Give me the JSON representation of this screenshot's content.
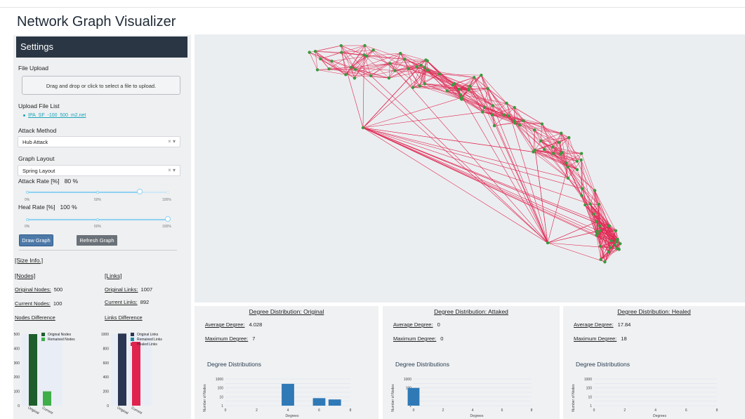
{
  "app": {
    "title": "Network Graph Visualizer"
  },
  "sidebar": {
    "header": "Settings",
    "file_upload": {
      "label": "File Upload",
      "dropzone": "Drag and drop or click to select a file to upload."
    },
    "upload_list": {
      "label": "Upload File List",
      "files": [
        "IPA_SF_-100_500_m2.net"
      ]
    },
    "attack_method": {
      "label": "Attack Method",
      "value": "Hub Attack",
      "clear": "×",
      "caret": "▾"
    },
    "graph_layout": {
      "label": "Graph Layout",
      "value": "Spring Layout",
      "clear": "×",
      "caret": "▾"
    },
    "attack_rate": {
      "label": "Attack Rate [%]",
      "display": "80 %",
      "value": 80,
      "ticks": [
        "0%",
        "50%",
        "100%"
      ]
    },
    "heal_rate": {
      "label": "Heal Rate [%]",
      "display": "100 %",
      "value": 100,
      "ticks": [
        "0%",
        "50%",
        "100%"
      ]
    },
    "buttons": {
      "draw": "Draw Graph",
      "refresh": "Refresh Graph"
    },
    "size_info": {
      "title": "[Size Info.]",
      "nodes_header": "[Nodes]",
      "links_header": "[Links]",
      "original_nodes_label": "Original Nodes:",
      "original_nodes": "500",
      "current_nodes_label": "Current Nodes:",
      "current_nodes": "100",
      "original_links_label": "Original Links:",
      "original_links": "1007",
      "current_links_label": "Current Links:",
      "current_links": "892",
      "nodes_diff_title": "Nodes Difference",
      "links_diff_title": "Links Difference"
    }
  },
  "chart_data": [
    {
      "type": "bar",
      "title": "Nodes Difference",
      "categories": [
        "Original",
        "Current"
      ],
      "series": [
        {
          "name": "Original Nodes",
          "color": "#1d5e2c",
          "values": [
            500,
            0
          ]
        },
        {
          "name": "Remained Nodes",
          "color": "#3fae49",
          "values": [
            0,
            100
          ]
        }
      ],
      "ylim": [
        0,
        500
      ],
      "yticks": [
        "0",
        "100",
        "200",
        "300",
        "400",
        "500"
      ],
      "legend": "top-right"
    },
    {
      "type": "bar",
      "title": "Links Difference",
      "categories": [
        "Original",
        "Current"
      ],
      "series": [
        {
          "name": "Original Links",
          "color": "#2a3652",
          "values": [
            1007,
            0
          ]
        },
        {
          "name": "Remained Links",
          "color": "#1f8a9e",
          "values": [
            0,
            0
          ]
        },
        {
          "name": "Healed Links",
          "color": "#e0224f",
          "values": [
            0,
            892
          ]
        }
      ],
      "ylim": [
        0,
        1000
      ],
      "yticks": [
        "0",
        "200",
        "400",
        "600",
        "800",
        "1000"
      ],
      "legend": "top-right"
    },
    {
      "type": "bar",
      "title": "Degree Distributions",
      "panel_title": "Degree Distribution: Original",
      "xlabel": "Degrees",
      "ylabel": "Number of Nodes",
      "yscale": "log",
      "x": [
        4,
        6,
        7
      ],
      "values": [
        286,
        7,
        5
      ],
      "xticks": [
        "0",
        "2",
        "4",
        "6",
        "8"
      ],
      "yticks": [
        "1",
        "10",
        "100",
        "1000"
      ],
      "xlim": [
        0,
        8
      ]
    },
    {
      "type": "bar",
      "title": "Degree Distributions",
      "panel_title": "Degree Distribution: Attaked",
      "xlabel": "Degrees",
      "ylabel": "Number of Nodes",
      "yscale": "log",
      "x": [
        0
      ],
      "values": [
        100
      ],
      "xticks": [
        "0",
        "2",
        "4",
        "6",
        "8"
      ],
      "yticks": [
        "1",
        "10",
        "100",
        "1000"
      ],
      "xlim": [
        0,
        8
      ]
    },
    {
      "type": "bar",
      "title": "Degree Distributions",
      "panel_title": "Degree Distribution: Healed",
      "xlabel": "Degrees",
      "ylabel": "Number of Nodes",
      "yscale": "log",
      "x": [],
      "values": [],
      "xticks": [
        "0",
        "2",
        "4",
        "6",
        "8"
      ],
      "yticks": [
        "1",
        "10",
        "100",
        "1000"
      ],
      "xlim": [
        0,
        8
      ]
    }
  ],
  "degree_panels": [
    {
      "title": "Degree Distribution: Original",
      "avg_label": "Average Degree:",
      "avg": "4.028",
      "max_label": "Maximum Degree:",
      "max": "7",
      "sub": "Degree Distributions",
      "xlabel": "Degrees",
      "ylabel": "Number of Nodes"
    },
    {
      "title": "Degree Distribution: Attaked",
      "avg_label": "Average Degree:",
      "avg": "0",
      "max_label": "Maximum Degree:",
      "max": "0",
      "sub": "Degree Distributions",
      "xlabel": "Degrees",
      "ylabel": "Number of Nodes"
    },
    {
      "title": "Degree Distribution: Healed",
      "avg_label": "Average Degree:",
      "avg": "17.84",
      "max_label": "Maximum Degree:",
      "max": "18",
      "sub": "Degree Distributions",
      "xlabel": "Degrees",
      "ylabel": "Number of Nodes"
    }
  ],
  "network_graph": {
    "edge_color": "#e0224f",
    "node_color": "#3a9a3f",
    "background": "#ebeef0",
    "layout": "Spring Layout"
  }
}
